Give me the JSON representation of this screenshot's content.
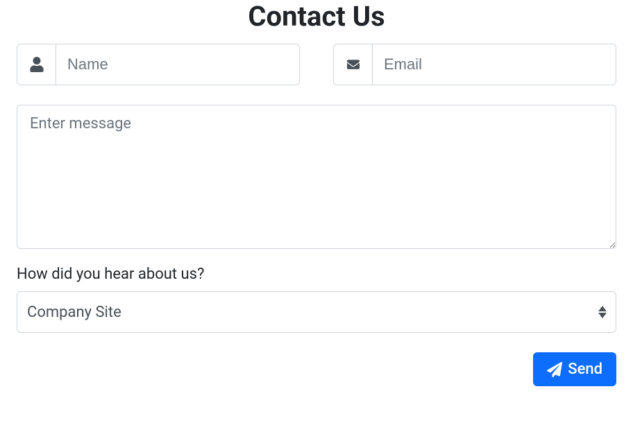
{
  "title": "Contact Us",
  "name_field": {
    "placeholder": "Name",
    "value": ""
  },
  "email_field": {
    "placeholder": "Email",
    "value": ""
  },
  "message_field": {
    "placeholder": "Enter message",
    "value": ""
  },
  "source_label": "How did you hear about us?",
  "source_selected": "Company Site",
  "send_label": "Send"
}
